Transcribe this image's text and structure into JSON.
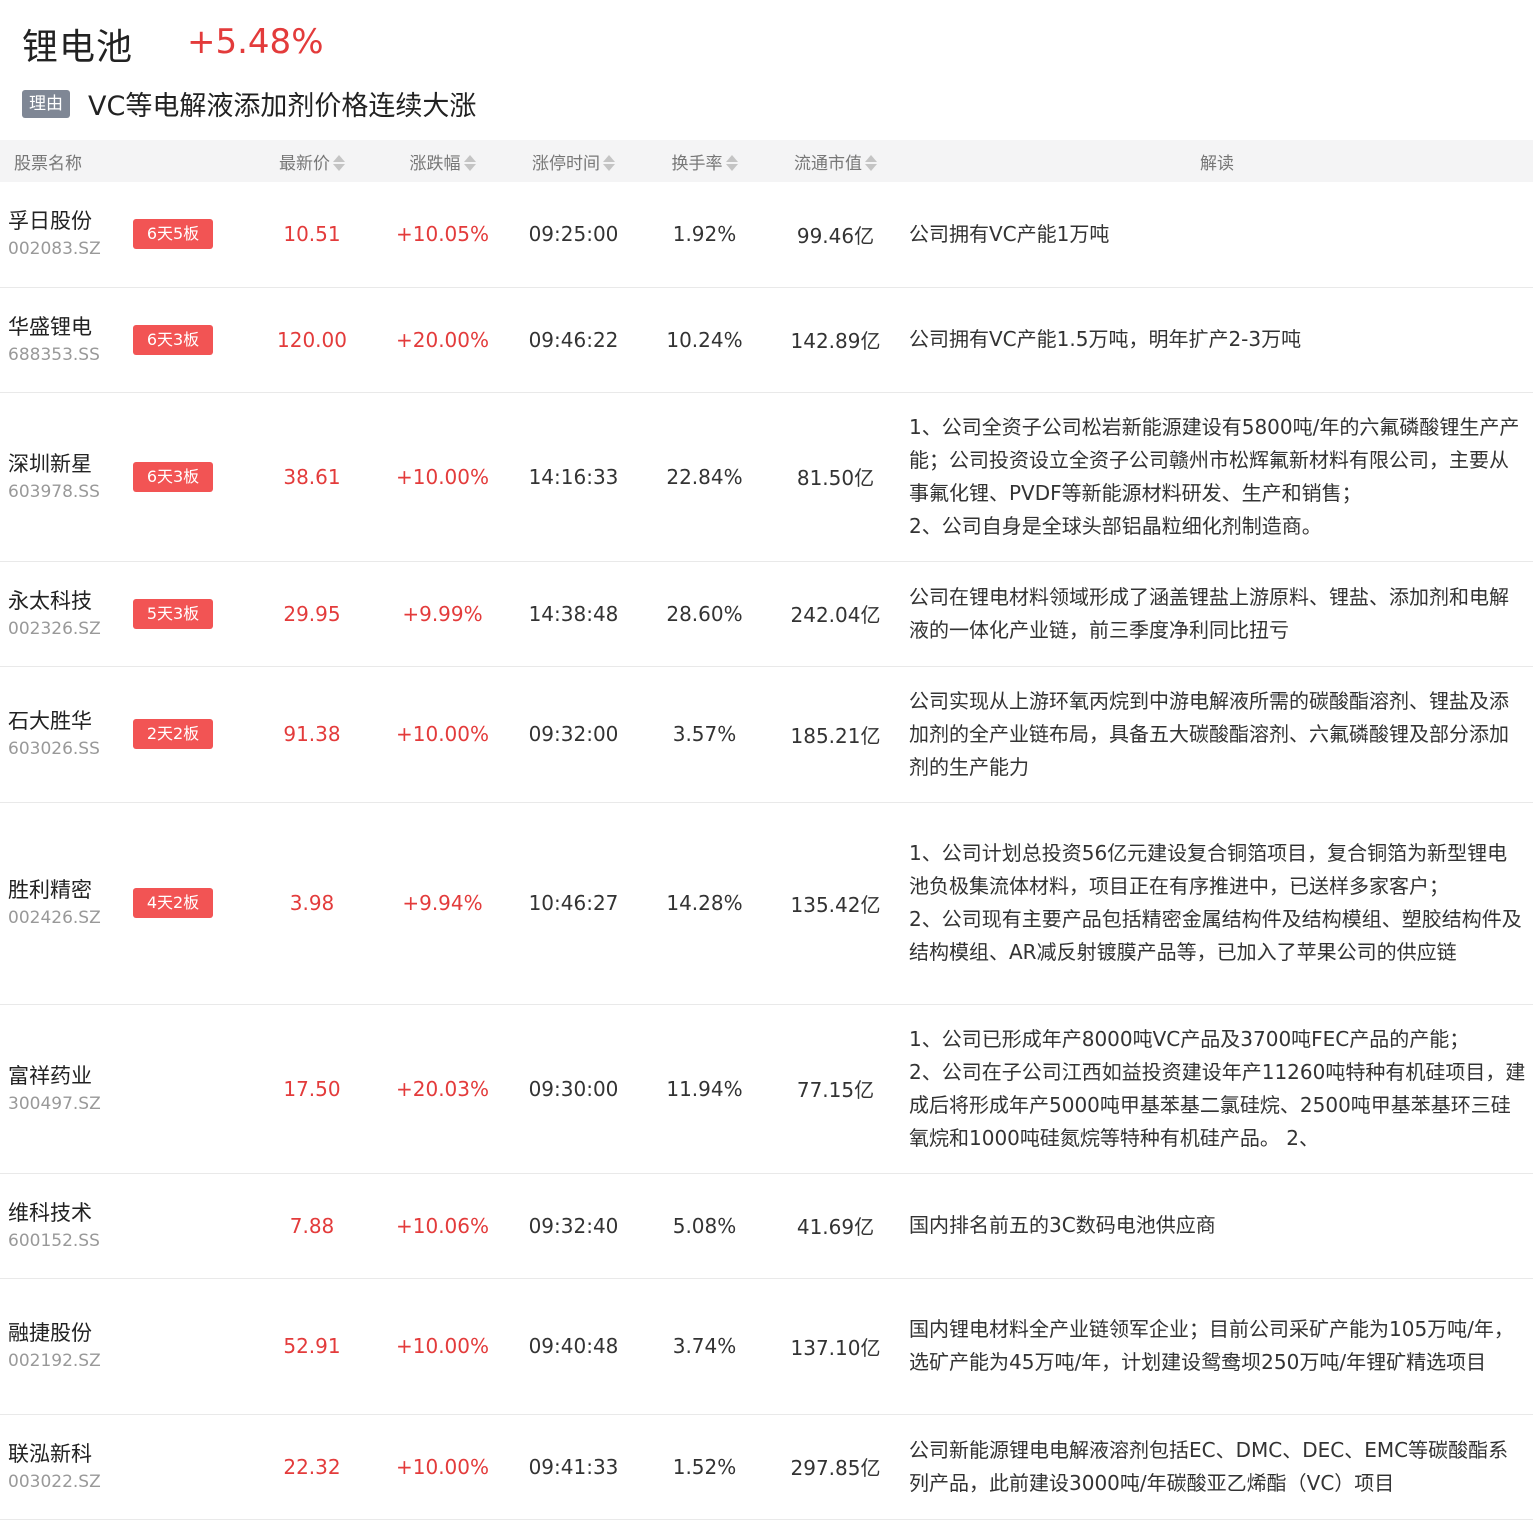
{
  "header": {
    "title": "锂电池",
    "change": "+5.48%",
    "reason_tag": "理由",
    "reason": "VC等电解液添加剂价格连续大涨"
  },
  "columns": {
    "name": "股票名称",
    "price": "最新价",
    "change": "涨跌幅",
    "limit_time": "涨停时间",
    "turnover": "换手率",
    "market_cap": "流通市值",
    "desc": "解读"
  },
  "colors": {
    "up": "#e33b3b",
    "badge": "#f25454",
    "tag": "#7f8795"
  },
  "rows": [
    {
      "name": "孚日股份",
      "code": "002083.SZ",
      "badge": "6天5板",
      "price": "10.51",
      "change": "+10.05%",
      "time": "09:25:00",
      "turnover": "1.92%",
      "cap": "99.46亿",
      "desc": "公司拥有VC产能1万吨"
    },
    {
      "name": "华盛锂电",
      "code": "688353.SS",
      "badge": "6天3板",
      "price": "120.00",
      "change": "+20.00%",
      "time": "09:46:22",
      "turnover": "10.24%",
      "cap": "142.89亿",
      "desc": "公司拥有VC产能1.5万吨，明年扩产2-3万吨"
    },
    {
      "name": "深圳新星",
      "code": "603978.SS",
      "badge": "6天3板",
      "price": "38.61",
      "change": "+10.00%",
      "time": "14:16:33",
      "turnover": "22.84%",
      "cap": "81.50亿",
      "desc": "1、公司全资子公司松岩新能源建设有5800吨/年的六氟磷酸锂生产产能；公司投资设立全资子公司赣州市松辉氟新材料有限公司，主要从事氟化锂、PVDF等新能源材料研发、生产和销售；\n2、公司自身是全球头部铝晶粒细化剂制造商。"
    },
    {
      "name": "永太科技",
      "code": "002326.SZ",
      "badge": "5天3板",
      "price": "29.95",
      "change": "+9.99%",
      "time": "14:38:48",
      "turnover": "28.60%",
      "cap": "242.04亿",
      "desc": "公司在锂电材料领域形成了涵盖锂盐上游原料、锂盐、添加剂和电解液的一体化产业链，前三季度净利同比扭亏"
    },
    {
      "name": "石大胜华",
      "code": "603026.SS",
      "badge": "2天2板",
      "price": "91.38",
      "change": "+10.00%",
      "time": "09:32:00",
      "turnover": "3.57%",
      "cap": "185.21亿",
      "desc": "公司实现从上游环氧丙烷到中游电解液所需的碳酸酯溶剂、锂盐及添加剂的全产业链布局，具备五大碳酸酯溶剂、六氟磷酸锂及部分添加剂的生产能力"
    },
    {
      "name": "胜利精密",
      "code": "002426.SZ",
      "badge": "4天2板",
      "price": "3.98",
      "change": "+9.94%",
      "time": "10:46:27",
      "turnover": "14.28%",
      "cap": "135.42亿",
      "desc": "1、公司计划总投资56亿元建设复合铜箔项目，复合铜箔为新型锂电池负极集流体材料，项目正在有序推进中，已送样多家客户；\n2、公司现有主要产品包括精密金属结构件及结构模组、塑胶结构件及结构模组、AR减反射镀膜产品等，已加入了苹果公司的供应链"
    },
    {
      "name": "富祥药业",
      "code": "300497.SZ",
      "badge": "",
      "price": "17.50",
      "change": "+20.03%",
      "time": "09:30:00",
      "turnover": "11.94%",
      "cap": "77.15亿",
      "desc": "1、公司已形成年产8000吨VC产品及3700吨FEC产品的产能；\n2、公司在子公司江西如益投资建设年产11260吨特种有机硅项目，建成后将形成年产5000吨甲基苯基二氯硅烷、2500吨甲基苯基环三硅氧烷和1000吨硅氮烷等特种有机硅产品。 2、"
    },
    {
      "name": "维科技术",
      "code": "600152.SS",
      "badge": "",
      "price": "7.88",
      "change": "+10.06%",
      "time": "09:32:40",
      "turnover": "5.08%",
      "cap": "41.69亿",
      "desc": "国内排名前五的3C数码电池供应商"
    },
    {
      "name": "融捷股份",
      "code": "002192.SZ",
      "badge": "",
      "price": "52.91",
      "change": "+10.00%",
      "time": "09:40:48",
      "turnover": "3.74%",
      "cap": "137.10亿",
      "desc": "国内锂电材料全产业链领军企业；目前公司采矿产能为105万吨/年，选矿产能为45万吨/年，计划建设鸳鸯坝250万吨/年锂矿精选项目"
    },
    {
      "name": "联泓新科",
      "code": "003022.SZ",
      "badge": "",
      "price": "22.32",
      "change": "+10.00%",
      "time": "09:41:33",
      "turnover": "1.52%",
      "cap": "297.85亿",
      "desc": "公司新能源锂电电解液溶剂包括EC、DMC、DEC、EMC等碳酸酯系列产品，此前建设3000吨/年碳酸亚乙烯酯（VC）项目"
    }
  ]
}
